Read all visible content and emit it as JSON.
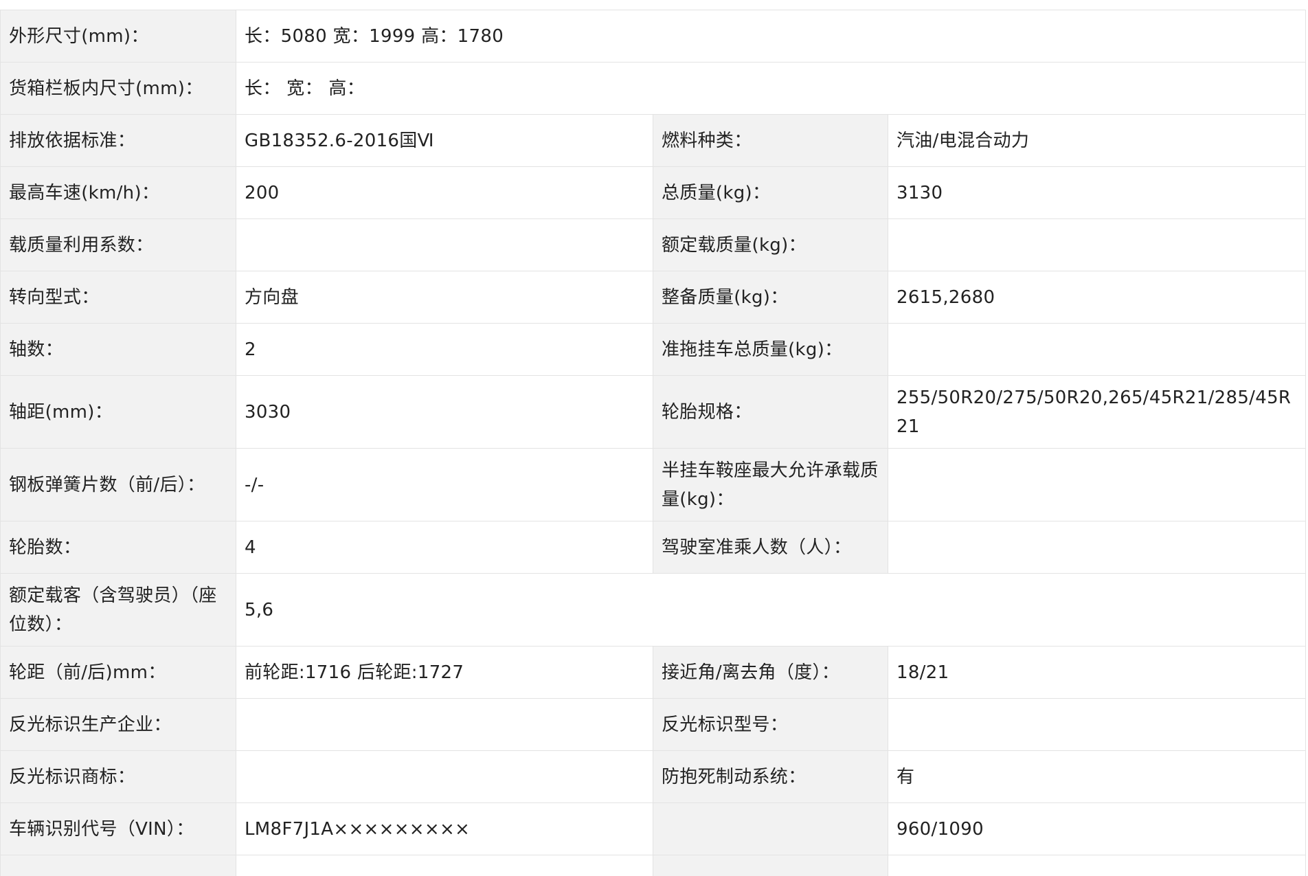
{
  "rows": [
    {
      "l1": "外形尺寸(mm)：",
      "v1": "长：5080 宽：1999 高：1780"
    },
    {
      "l1": "货箱栏板内尺寸(mm)：",
      "v1": "长：  宽：  高："
    },
    {
      "l1": "排放依据标准：",
      "v1": "GB18352.6-2016国Ⅵ",
      "l2": "燃料种类：",
      "v2": "汽油/电混合动力"
    },
    {
      "l1": "最高车速(km/h)：",
      "v1": "200",
      "l2": "总质量(kg)：",
      "v2": "3130"
    },
    {
      "l1": "载质量利用系数：",
      "v1": "",
      "l2": "额定载质量(kg)：",
      "v2": ""
    },
    {
      "l1": "转向型式：",
      "v1": "方向盘",
      "l2": "整备质量(kg)：",
      "v2": "2615,2680"
    },
    {
      "l1": "轴数：",
      "v1": "2",
      "l2": "准拖挂车总质量(kg)：",
      "v2": ""
    },
    {
      "l1": "轴距(mm)：",
      "v1": "3030",
      "l2": "轮胎规格：",
      "v2": "255/50R20/275/50R20,265/45R21/285/45R21"
    },
    {
      "l1": "钢板弹簧片数（前/后）：",
      "v1": "-/-",
      "l2": "半挂车鞍座最大允许承载质量(kg)：",
      "v2": ""
    },
    {
      "l1": "轮胎数：",
      "v1": "4",
      "l2": "驾驶室准乘人数（人）：",
      "v2": ""
    },
    {
      "l1": "额定载客（含驾驶员）（座位数）：",
      "v1": "5,6"
    },
    {
      "l1": "轮距（前/后)mm：",
      "v1": "前轮距:1716 后轮距:1727",
      "l2": "接近角/离去角（度）：",
      "v2": "18/21"
    },
    {
      "l1": "反光标识生产企业：",
      "v1": "",
      "l2": "反光标识型号：",
      "v2": ""
    },
    {
      "l1": "反光标识商标：",
      "v1": "",
      "l2": "防抱死制动系统：",
      "v2": "有"
    },
    {
      "l1": "车辆识别代号（VIN）：",
      "v1": "LM8F7J1A×××××××××",
      "l2": "",
      "v2": "960/1090"
    }
  ]
}
